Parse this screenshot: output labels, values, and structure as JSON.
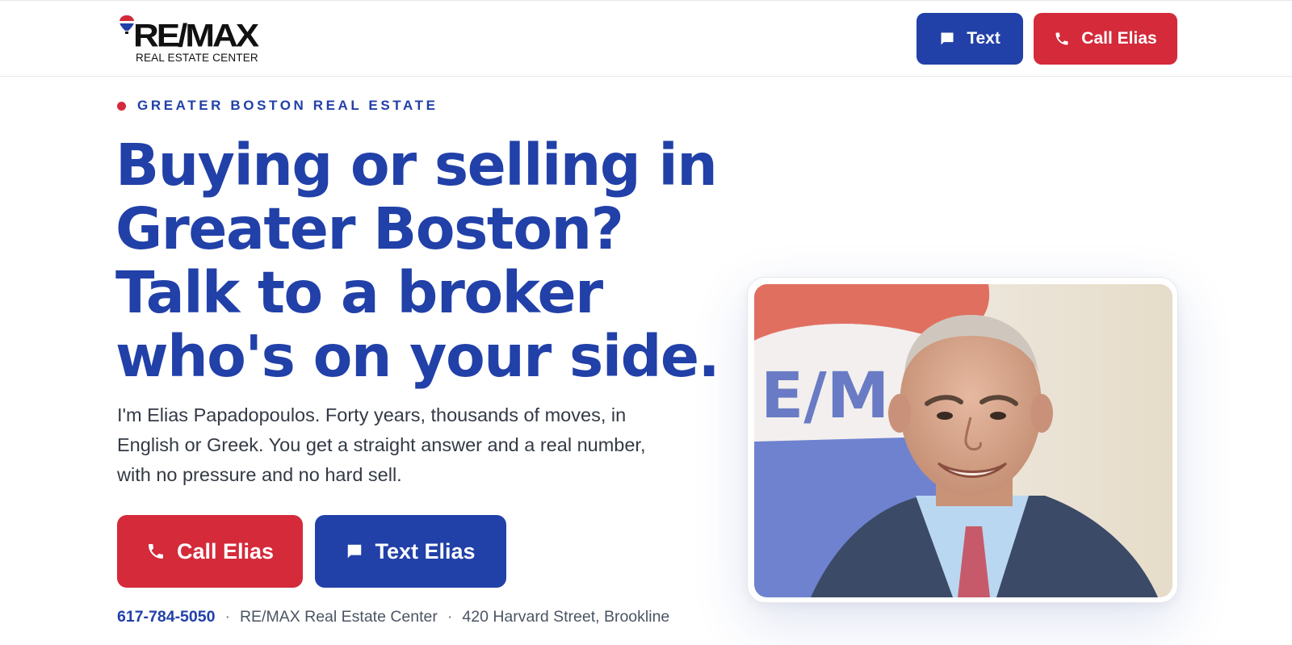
{
  "header": {
    "logo": {
      "wordmark": "RE/MAX",
      "subtitle": "REAL ESTATE CENTER"
    },
    "text_button_label": "Text",
    "call_button_label": "Call Elias"
  },
  "hero": {
    "eyebrow": "GREATER BOSTON REAL ESTATE",
    "headline_lines": [
      "Buying or selling in",
      "Greater Boston?",
      "Talk to a broker",
      "who's on your side."
    ],
    "intro_lines": [
      "I'm Elias Papadopoulos. Forty years, thousands of moves, in",
      "English or Greek. You get a straight answer and a real number,",
      "with no pressure and no hard sell."
    ],
    "call_button_label": "Call Elias",
    "text_button_label": "Text Elias",
    "contact": {
      "phone": "617-784-5050",
      "separator": "·",
      "office": "RE/MAX Real Estate Center",
      "address": "420 Harvard Street, Brookline"
    }
  },
  "photo": {
    "sign_text": "E/M"
  },
  "colors": {
    "brand_blue": "#2140a8",
    "brand_red": "#d42a3a"
  },
  "icons": {
    "text": "chat-bubble-icon",
    "call": "phone-icon",
    "logo": "hot-air-balloon-icon"
  }
}
